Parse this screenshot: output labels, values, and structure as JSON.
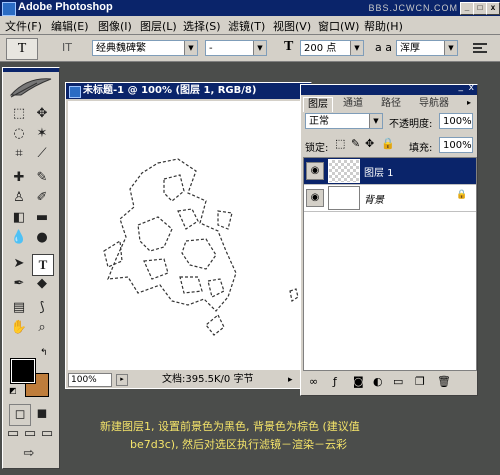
{
  "app": {
    "title": "Adobe Photoshop",
    "watermark": "BBS.JCWCN.COM"
  },
  "menu": [
    "文件(F)",
    "编辑(E)",
    "图像(I)",
    "图层(L)",
    "选择(S)",
    "滤镜(T)",
    "视图(V)",
    "窗口(W)",
    "帮助(H)"
  ],
  "options": {
    "tool_symbol": "T",
    "orient_symbol": "IT",
    "font_family": "经典魏碑繁",
    "font_style": "-",
    "size_icon": "T",
    "font_size": "200 点",
    "aa_icon": "a a",
    "aa_mode": "浑厚"
  },
  "document": {
    "title": "未标题-1 @ 100% (图层 1, RGB/8)",
    "zoom": "100%",
    "status": "文档:395.5K/0 字节"
  },
  "layers_panel": {
    "tabs": [
      "图层",
      "通道",
      "路径",
      "导航器"
    ],
    "blend_mode": "正常",
    "opacity_label": "不透明度:",
    "opacity_value": "100%",
    "lock_label": "锁定:",
    "fill_label": "填充:",
    "fill_value": "100%",
    "layers": [
      {
        "name": "图层 1",
        "selected": true
      },
      {
        "name": "背景",
        "selected": false,
        "locked": true
      }
    ]
  },
  "colors": {
    "foreground": "#000000",
    "background": "#be7d3c"
  },
  "caption": {
    "line1": "新建图层1, 设置前景色为黑色, 背景色为棕色 (建议值",
    "line2": "be7d3c), 然后对选区执行滤镜－渲染－云彩"
  }
}
